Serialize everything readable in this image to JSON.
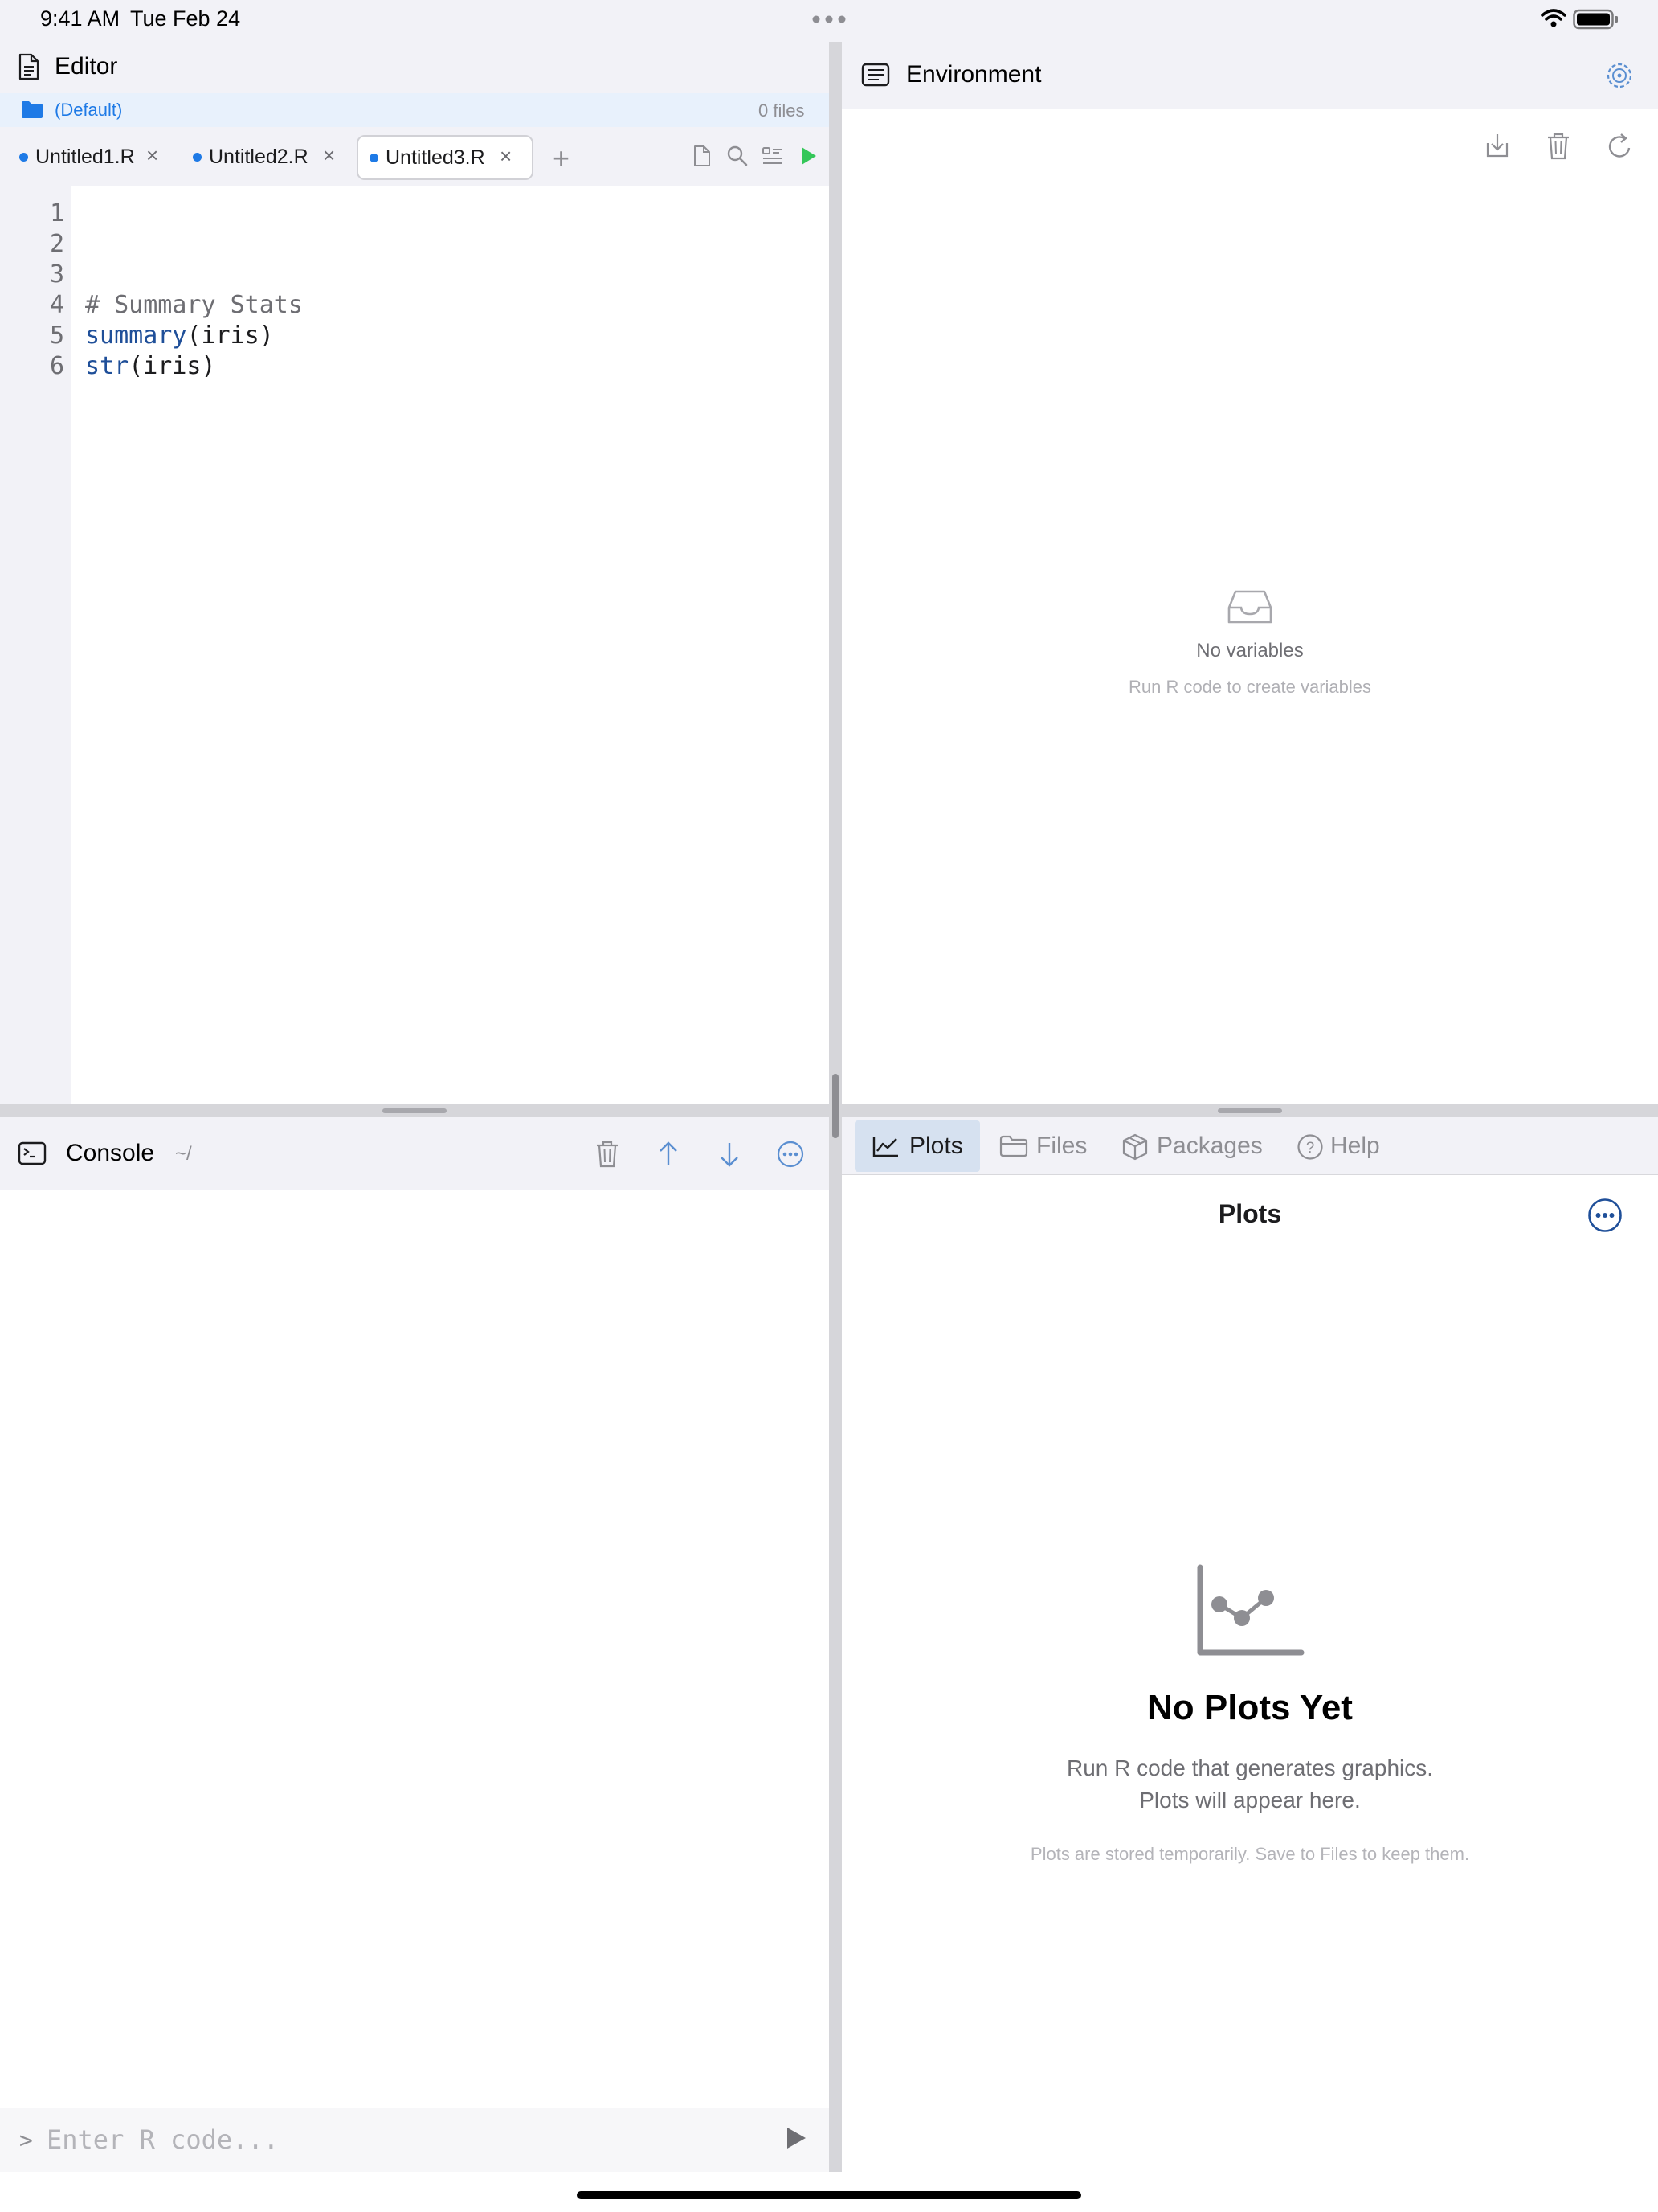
{
  "status_bar": {
    "time": "9:41 AM",
    "date": "Tue Feb 24"
  },
  "editor": {
    "title": "Editor",
    "project_name": "(Default)",
    "file_count": "0 files",
    "tabs": [
      {
        "label": "Untitled1.R",
        "modified": true,
        "active": false
      },
      {
        "label": "Untitled2.R",
        "modified": true,
        "active": false
      },
      {
        "label": "Untitled3.R",
        "modified": true,
        "active": true
      }
    ],
    "add_tab_label": "+",
    "toolbar_icons": [
      "new-file-icon",
      "search-icon",
      "outline-icon",
      "run-icon"
    ],
    "line_numbers": [
      "1",
      "2",
      "3",
      "4",
      "5",
      "6"
    ],
    "code_lines": [
      "",
      "",
      "",
      "# Summary Stats",
      "summary(iris)",
      "str(iris)"
    ],
    "code_tokens": {
      "line4_comment": "# Summary Stats",
      "line5_fn": "summary",
      "line5_rest": "(iris)",
      "line6_fn": "str",
      "line6_rest": "(iris)"
    }
  },
  "console": {
    "title": "Console",
    "path": "~/",
    "prompt": ">",
    "input_placeholder": "Enter R code...",
    "input_value": "",
    "toolbar_icons": [
      "trash-icon",
      "arrow-up-icon",
      "arrow-down-icon",
      "more-icon"
    ]
  },
  "environment": {
    "title": "Environment",
    "toolbar_icons": [
      "import-icon",
      "trash-icon",
      "refresh-icon"
    ],
    "empty_title": "No variables",
    "empty_subtitle": "Run R code to create variables"
  },
  "bottom_right": {
    "tabs": [
      {
        "label": "Plots",
        "icon": "chart-icon",
        "active": true
      },
      {
        "label": "Files",
        "icon": "folder-icon",
        "active": false
      },
      {
        "label": "Packages",
        "icon": "package-icon",
        "active": false
      },
      {
        "label": "Help",
        "icon": "help-icon",
        "active": false
      }
    ],
    "plots_title": "Plots",
    "empty_title": "No Plots Yet",
    "empty_line1": "Run R code that generates graphics.",
    "empty_line2": "Plots will appear here.",
    "note": "Plots are stored temporarily. Save to Files to keep them."
  },
  "colors": {
    "accent_blue": "#1e7ae6",
    "run_green": "#34c759",
    "code_function": "#1f4f99",
    "code_comment": "#6e6e73"
  }
}
